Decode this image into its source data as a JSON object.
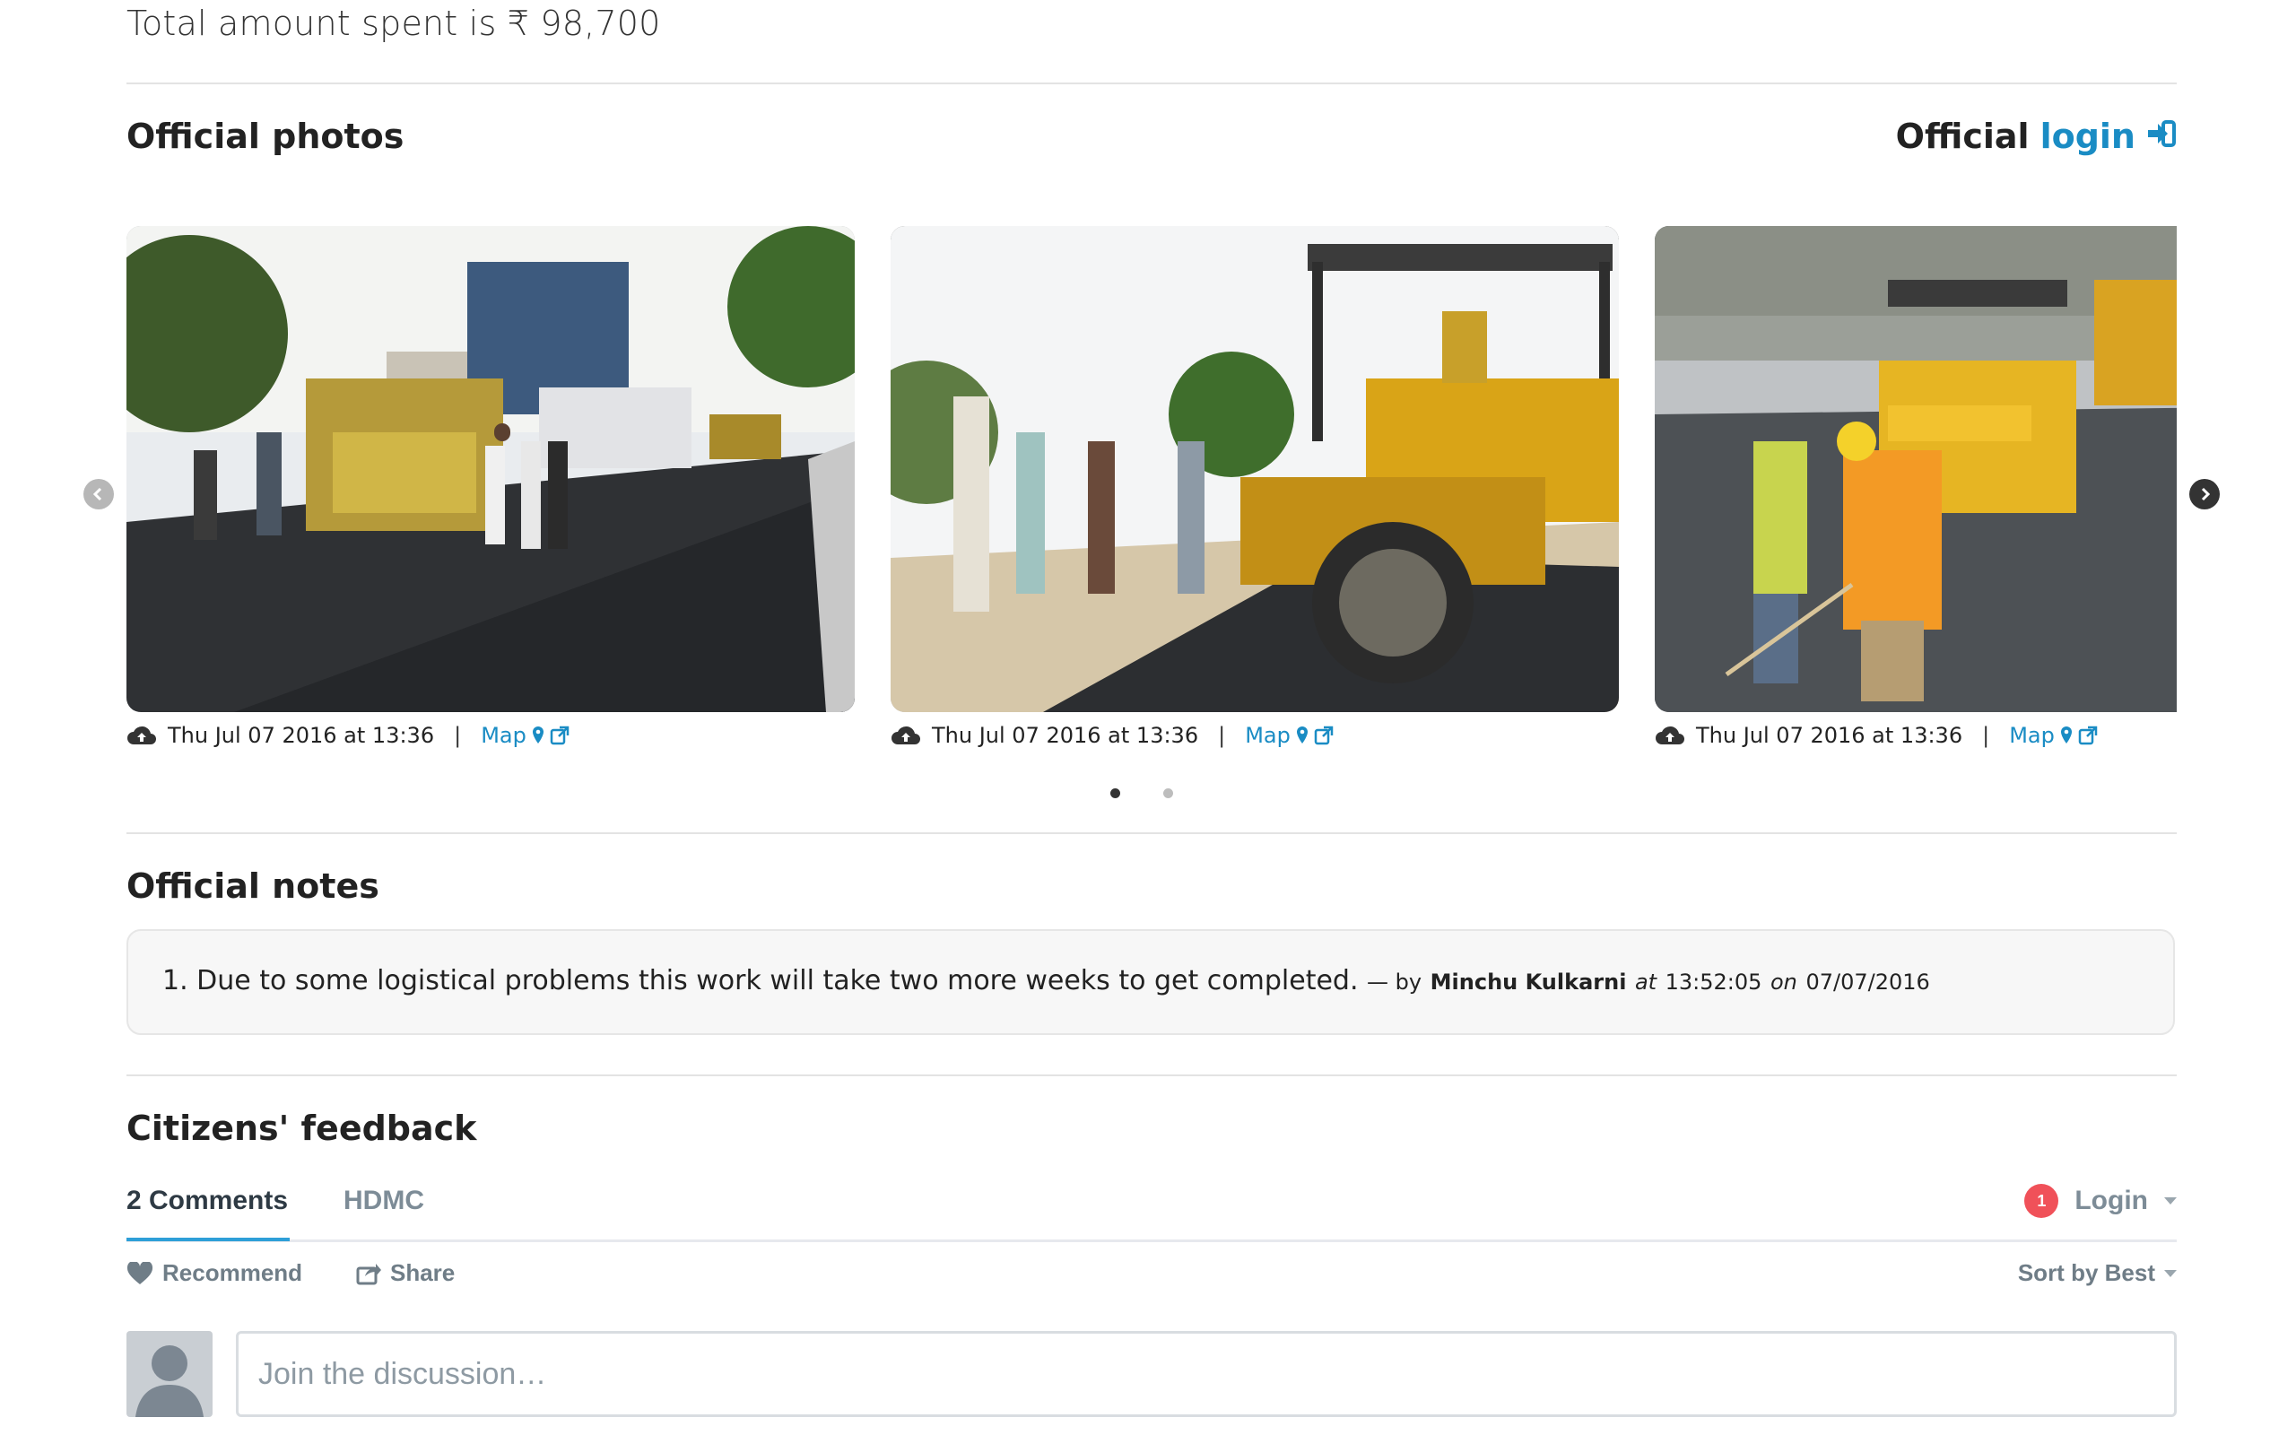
{
  "budget": {
    "total_spent_text": "Total amount spent is ₹ 98,700"
  },
  "official_photos": {
    "heading": "Official photos",
    "login_prefix": "Official",
    "login_link": "login",
    "photos": [
      {
        "timestamp": "Thu Jul 07 2016 at 13:36",
        "map_label": "Map"
      },
      {
        "timestamp": "Thu Jul 07 2016 at 13:36",
        "map_label": "Map"
      },
      {
        "timestamp": "Thu Jul 07 2016 at 13:36",
        "map_label": "Map"
      }
    ],
    "separator": "|",
    "carousel_pages": 2,
    "carousel_active_page": 1
  },
  "official_notes": {
    "heading": "Official notes",
    "notes": [
      {
        "number": "1.",
        "text": "Due to some logistical problems this work will take two more weeks to get completed.",
        "by_prefix": "— by",
        "author": "Minchu Kulkarni",
        "at_label": "at",
        "time": "13:52:05",
        "on_label": "on",
        "date": "07/07/2016"
      }
    ]
  },
  "citizens_feedback": {
    "heading": "Citizens' feedback",
    "tabs": [
      "2 Comments",
      "HDMC"
    ],
    "notification_count": "1",
    "login_label": "Login",
    "recommend_label": "Recommend",
    "share_label": "Share",
    "sort_label": "Sort by Best",
    "compose_placeholder": "Join the discussion…"
  },
  "colors": {
    "link": "#1a8cc4",
    "disqus_accent": "#2e9fd8",
    "badge": "#f05159",
    "muted": "#7d8c97"
  },
  "icons": [
    "cloud-upload-icon",
    "map-marker-icon",
    "external-link-icon",
    "sign-in-icon",
    "chevron-left-icon",
    "chevron-right-icon",
    "heart-icon",
    "share-icon",
    "caret-down-icon",
    "avatar-icon"
  ]
}
